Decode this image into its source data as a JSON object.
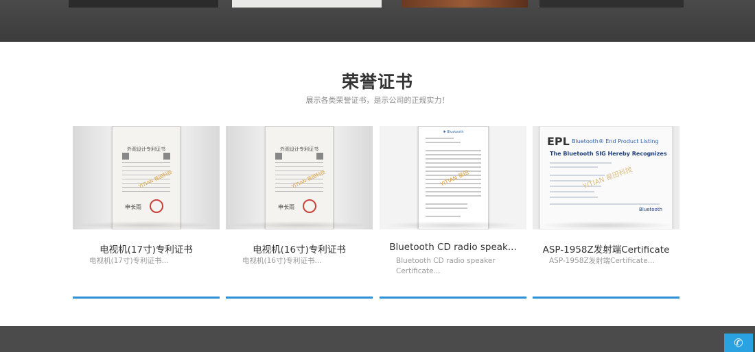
{
  "section": {
    "title": "荣誉证书",
    "subtitle": "展示各类荣誉证书，是示公司的正规实力！"
  },
  "cards": [
    {
      "title": "电视机(17寸)专利证书",
      "desc": "电视机(17寸)专利证书...",
      "image": "patent-certificate"
    },
    {
      "title": "电视机(16寸)专利证书",
      "desc": "电视机(16寸)专利证书...",
      "image": "patent-certificate"
    },
    {
      "title": "Bluetooth CD radio speak...",
      "desc": "Bluetooth CD radio speaker Certificate...",
      "image": "bluetooth-certificate-document"
    },
    {
      "title": "ASP-1958Z发射端Certificate",
      "desc": "ASP-1958Z发射端Certificate...",
      "image": "epl-bluetooth-listing"
    }
  ],
  "epl_cert": {
    "epl": "EPL",
    "sub": "Bluetooth® End Product Listing",
    "heading": "The Bluetooth SIG Hereby Recognizes",
    "brand": "Bluetooth"
  },
  "colors": {
    "accent": "#2a8fd6",
    "dark_band": "#4b4b4b",
    "phone": "#2aa1e0"
  },
  "floating": {
    "icon": "phone-icon"
  }
}
